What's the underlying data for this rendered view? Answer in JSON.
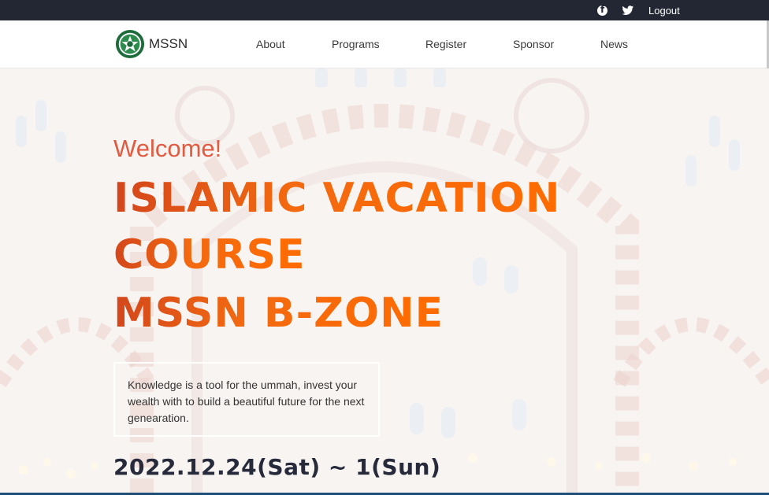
{
  "topbar": {
    "icons": [
      "facebook-icon",
      "twitter-icon"
    ],
    "logout_label": "Logout"
  },
  "nav": {
    "brand": "MSSN",
    "items": [
      {
        "label": "About"
      },
      {
        "label": "Programs"
      },
      {
        "label": "Register"
      },
      {
        "label": "Sponsor"
      },
      {
        "label": "News"
      }
    ]
  },
  "hero": {
    "welcome": "Welcome!",
    "title_lines": [
      "ISLAMIC VACATION",
      "COURSE",
      "MSSN B-ZONE"
    ],
    "description": "Knowledge is a tool for the ummah, invest your wealth with to build a beautiful future for the next genearation.",
    "date": "2022.12.24(Sat) ~ 1(Sun)"
  },
  "colors": {
    "topbar": "#232633",
    "accent": "#ff6b00",
    "welcome": "#e25a40",
    "date": "#262a3a"
  }
}
